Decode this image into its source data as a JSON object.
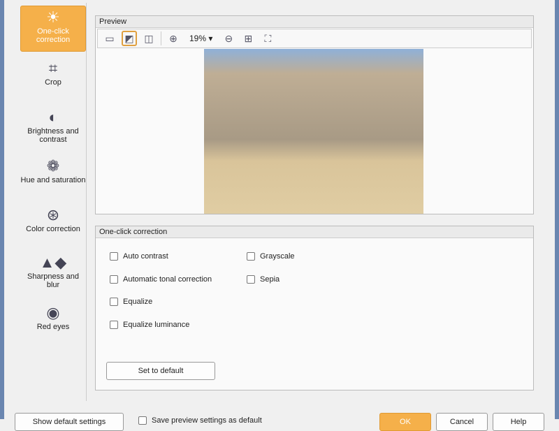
{
  "sidebar": {
    "items": [
      {
        "label": "One-click correction",
        "icon": "sun-icon"
      },
      {
        "label": "Crop",
        "icon": "crop-icon"
      },
      {
        "label": "Brightness and contrast",
        "icon": "brightness-icon"
      },
      {
        "label": "Hue and saturation",
        "icon": "palette-icon"
      },
      {
        "label": "Color correction",
        "icon": "color-circles-icon"
      },
      {
        "label": "Sharpness and blur",
        "icon": "drops-icon"
      },
      {
        "label": "Red eyes",
        "icon": "eye-icon"
      }
    ]
  },
  "preview": {
    "title": "Preview",
    "zoom": "19%"
  },
  "correction": {
    "title": "One-click correction",
    "options": [
      {
        "label": "Auto contrast",
        "checked": false
      },
      {
        "label": "Automatic tonal correction",
        "checked": false
      },
      {
        "label": "Equalize",
        "checked": false
      },
      {
        "label": "Equalize luminance",
        "checked": false
      },
      {
        "label": "Grayscale",
        "checked": false
      },
      {
        "label": "Sepia",
        "checked": false
      }
    ],
    "default_button": "Set to default"
  },
  "footer": {
    "left_button": "Show default settings",
    "checkbox": "Save preview settings as default",
    "ok": "OK",
    "cancel": "Cancel",
    "help": "Help"
  }
}
